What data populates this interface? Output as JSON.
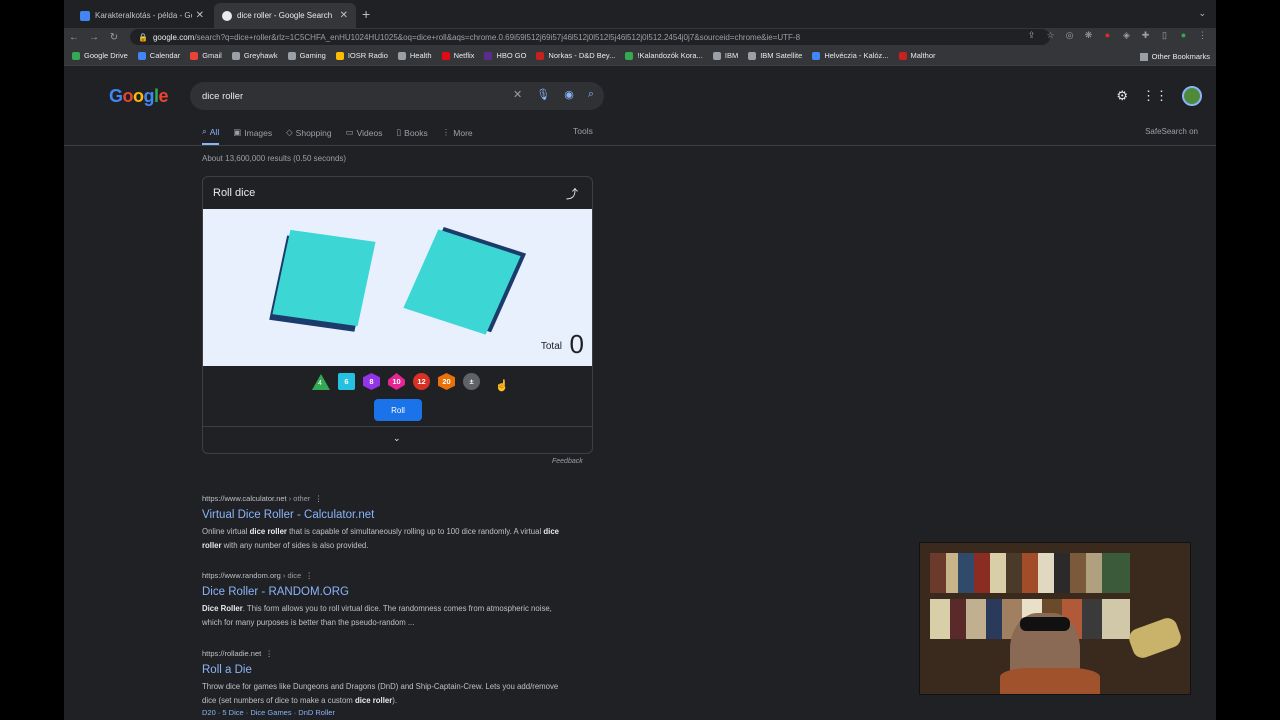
{
  "browser": {
    "tabs": [
      {
        "title": "Karakteralkotás - példa - Goog",
        "active": false
      },
      {
        "title": "dice roller - Google Search",
        "active": true
      }
    ],
    "url_host": "google.com",
    "url_rest": "/search?q=dice+roller&rlz=1C5CHFA_enHU1024HU1025&oq=dice+roll&aqs=chrome.0.69i59l512j69i57j46l512j0l512l5j46l512j0l512.2454j0j7&sourceid=chrome&ie=UTF-8",
    "bookmarks": [
      "Google Drive",
      "Calendar",
      "Gmail",
      "Greyhawk",
      "Gaming",
      "IOSR Radio",
      "Health",
      "Netflix",
      "HBO GO",
      "Norkas - D&D Bey...",
      "!Kalandozók Kora...",
      "IBM",
      "IBM Satellite",
      "Helvéczia - Kalóz...",
      "Malthor"
    ],
    "other_bookmarks": "Other Bookmarks"
  },
  "search": {
    "logo": "Google",
    "query": "dice roller",
    "tabs": [
      "All",
      "Images",
      "Shopping",
      "Videos",
      "Books",
      "More"
    ],
    "tools": "Tools",
    "safesearch": "SafeSearch on",
    "stats": "About 13,600,000 results (0.50 seconds)"
  },
  "dice_widget": {
    "title": "Roll dice",
    "total_label": "Total",
    "total_value": "0",
    "dice_types": [
      "4",
      "6",
      "8",
      "10",
      "12",
      "20",
      "±"
    ],
    "roll_label": "Roll",
    "feedback": "Feedback"
  },
  "results": [
    {
      "url": "https://www.calculator.net",
      "crumb": " › other",
      "title": "Virtual Dice Roller - Calculator.net",
      "snippet_html": "Online virtual <b>dice roller</b> that is capable of simultaneously rolling up to 100 dice randomly. A virtual <b>dice roller</b> with any number of sides is also provided."
    },
    {
      "url": "https://www.random.org",
      "crumb": " › dice",
      "title": "Dice Roller - RANDOM.ORG",
      "snippet_html": "<b>Dice Roller</b>. This form allows you to roll virtual dice. The randomness comes from atmospheric noise, which for many purposes is better than the pseudo-random ..."
    },
    {
      "url": "https://rolladie.net",
      "crumb": "",
      "title": "Roll a Die",
      "snippet_html": "Throw dice for games like Dungeons and Dragons (DnD) and Ship-Captain-Crew. Lets you add/remove dice (set numbers of dice to make a custom <b>dice roller</b>).",
      "links": "D20 · 5 Dice · Dice Games · DnD Roller"
    }
  ],
  "colors": {
    "background": "#202124",
    "link": "#8ab4f8",
    "dice_face": "#3cd7d4",
    "roll_button": "#1a73e8"
  }
}
